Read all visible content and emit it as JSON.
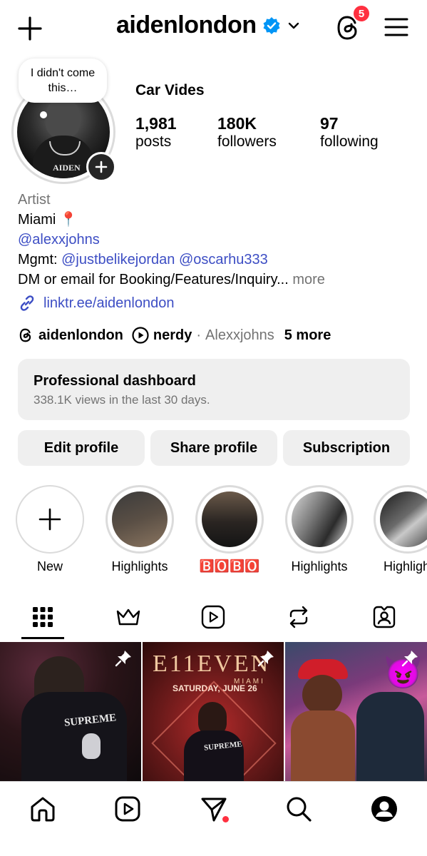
{
  "header": {
    "username": "aidenlondon",
    "threads_badge_count": "5"
  },
  "profile": {
    "note": "I didn't come this…",
    "display_name": "Car Vides",
    "avatar_text": "AIDEN",
    "stats": [
      {
        "value": "1,981",
        "label": "posts"
      },
      {
        "value": "180K",
        "label": "followers"
      },
      {
        "value": "97",
        "label": "following"
      }
    ],
    "category": "Artist",
    "bio_line1": "Miami 📍",
    "bio_mention": "@alexxjohns",
    "mgmt_prefix": "Mgmt:",
    "mgmt_mention1": "@justbelikejordan",
    "mgmt_mention2": "@oscarhu333",
    "bio_line4": "DM or email for Booking/Features/Inquiry...",
    "more_label": "more",
    "link": "linktr.ee/aidenlondon",
    "threads_handle": "aidenlondon",
    "channel_name": "nerdy",
    "channel_sep": "·",
    "channel_owner": "Alexxjohns",
    "more_links": "5 more"
  },
  "dashboard": {
    "title": "Professional dashboard",
    "subtitle": "338.1K views in the last 30 days."
  },
  "buttons": {
    "edit": "Edit profile",
    "share": "Share profile",
    "subscription": "Subscription"
  },
  "highlights": [
    {
      "label": "New"
    },
    {
      "label": "Highlights"
    },
    {
      "label": "🅱️🅾️🅱️🅾️"
    },
    {
      "label": "Highlights"
    },
    {
      "label": "Highligh"
    }
  ],
  "posts": [
    {
      "overlay_text": "SUPREME"
    },
    {
      "overlay_title": "E11EVEN",
      "overlay_sub": "MIAMI",
      "overlay_date": "SATURDAY, JUNE 26",
      "overlay_text": "SUPREME"
    },
    {
      "emoji": "😈"
    }
  ],
  "colors": {
    "accent": "#3d4ec4",
    "verified": "#0095f6",
    "notification": "#ff3040"
  }
}
